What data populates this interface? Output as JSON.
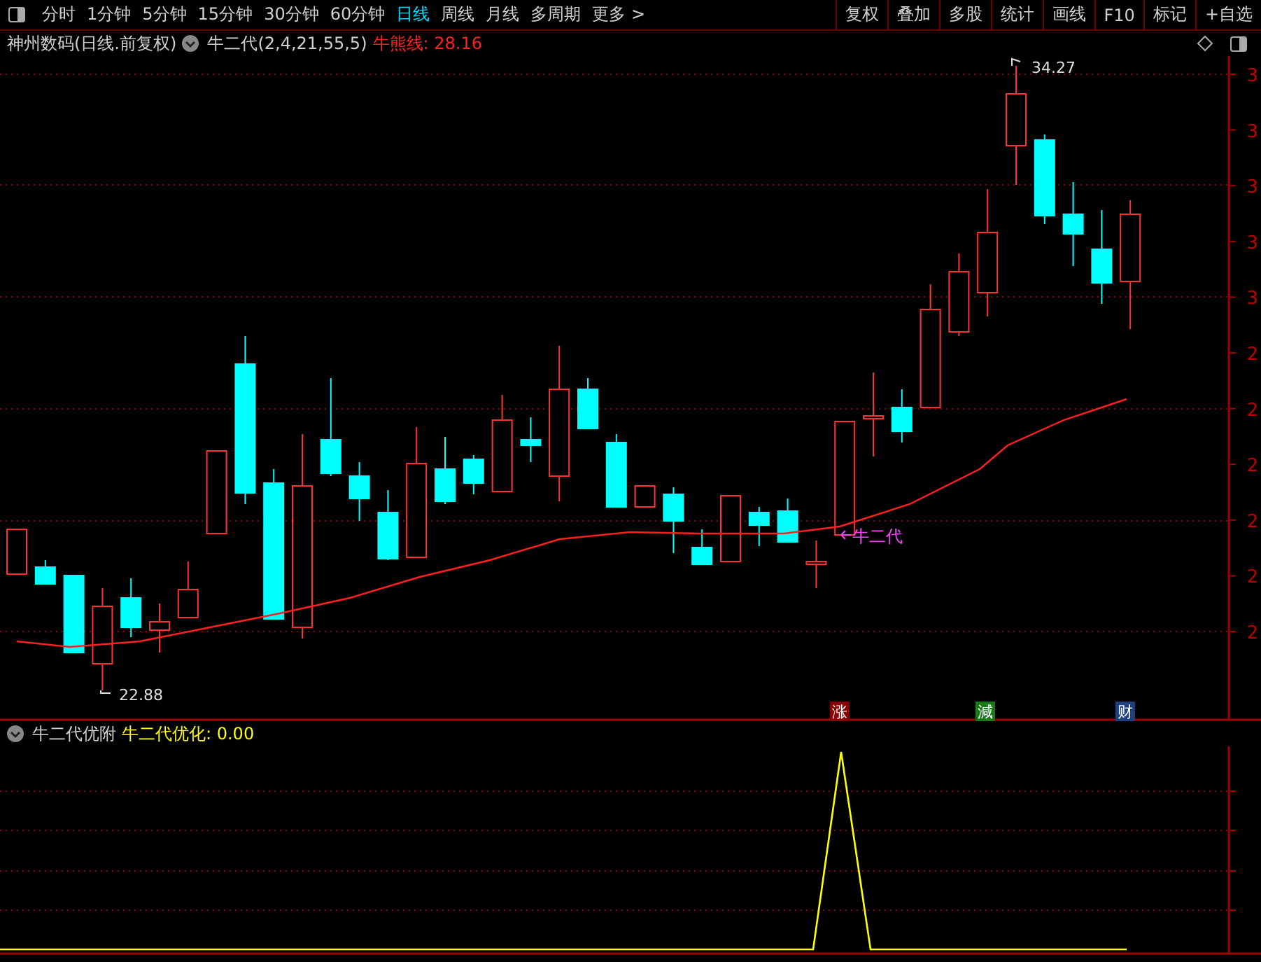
{
  "toolbar": {
    "periods": [
      {
        "label": "分时",
        "selected": false
      },
      {
        "label": "1分钟",
        "selected": false
      },
      {
        "label": "5分钟",
        "selected": false
      },
      {
        "label": "15分钟",
        "selected": false
      },
      {
        "label": "30分钟",
        "selected": false
      },
      {
        "label": "60分钟",
        "selected": false
      },
      {
        "label": "日线",
        "selected": true
      },
      {
        "label": "周线",
        "selected": false
      },
      {
        "label": "月线",
        "selected": false
      },
      {
        "label": "多周期",
        "selected": false
      },
      {
        "label": "更多 >",
        "selected": false
      }
    ],
    "buttons": [
      "复权",
      "叠加",
      "多股",
      "统计",
      "画线",
      "F10",
      "标记",
      "+自选"
    ]
  },
  "main_chart": {
    "title": "神州数码(日线.前复权)",
    "indicator": "牛二代(2,4,21,55,5)",
    "readout": "牛熊线: 28.16",
    "high_label": "34.27",
    "low_label": "22.88",
    "signal_label": "牛二代",
    "axis_labels": [
      "3",
      "3",
      "3",
      "3",
      "3",
      "2",
      "2",
      "2",
      "2",
      "2",
      "2"
    ],
    "markers": [
      {
        "text": "涨",
        "color": "#8b0000"
      },
      {
        "text": "減",
        "color": "#1a7a1a"
      },
      {
        "text": "财",
        "color": "#1f3f7f"
      }
    ]
  },
  "sub_chart": {
    "title": "牛二代优附",
    "readout": "牛二代优化: 0.00"
  }
}
